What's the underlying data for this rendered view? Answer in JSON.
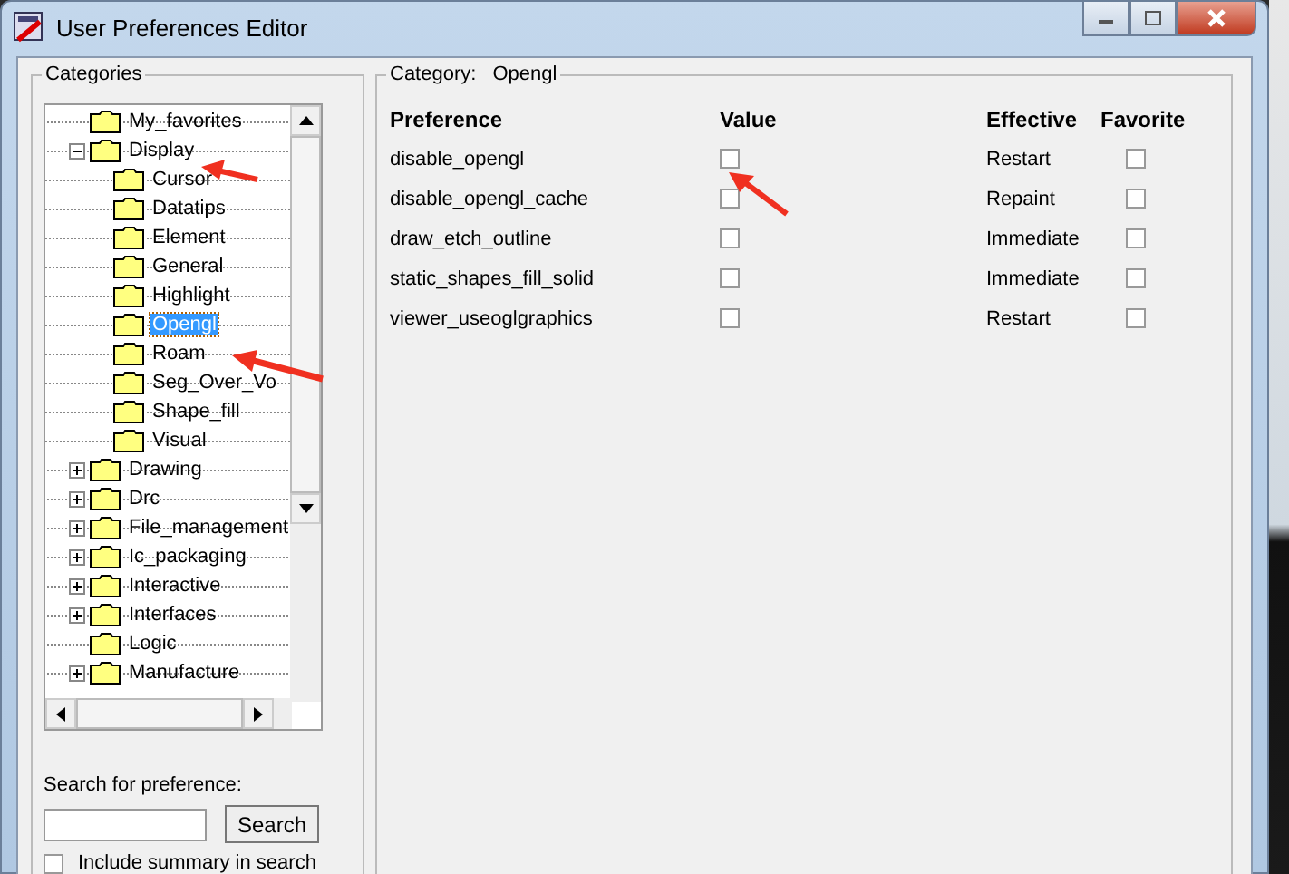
{
  "window": {
    "title": "User Preferences Editor"
  },
  "categories": {
    "title": "Categories",
    "tree": [
      {
        "label": "My_favorites",
        "kind": "leaf",
        "selected": false
      },
      {
        "label": "Display",
        "kind": "group",
        "expanded": true,
        "selected": false,
        "children": [
          {
            "label": "Cursor",
            "selected": false
          },
          {
            "label": "Datatips",
            "selected": false
          },
          {
            "label": "Element",
            "selected": false
          },
          {
            "label": "General",
            "selected": false
          },
          {
            "label": "Highlight",
            "selected": false
          },
          {
            "label": "Opengl",
            "selected": true
          },
          {
            "label": "Roam",
            "selected": false
          },
          {
            "label": "Seg_Over_Vo",
            "selected": false
          },
          {
            "label": "Shape_fill",
            "selected": false
          },
          {
            "label": "Visual",
            "selected": false
          }
        ]
      },
      {
        "label": "Drawing",
        "kind": "group",
        "expanded": false,
        "selected": false
      },
      {
        "label": "Drc",
        "kind": "group",
        "expanded": false,
        "selected": false
      },
      {
        "label": "File_management",
        "kind": "group",
        "expanded": false,
        "selected": false
      },
      {
        "label": "Ic_packaging",
        "kind": "group",
        "expanded": false,
        "selected": false
      },
      {
        "label": "Interactive",
        "kind": "group",
        "expanded": false,
        "selected": false
      },
      {
        "label": "Interfaces",
        "kind": "group",
        "expanded": false,
        "selected": false
      },
      {
        "label": "Logic",
        "kind": "leaf",
        "selected": false
      },
      {
        "label": "Manufacture",
        "kind": "group",
        "expanded": false,
        "selected": false
      }
    ],
    "search_label": "Search for preference:",
    "search_button": "Search",
    "include_summary": {
      "label": "Include summary in search",
      "checked": false
    }
  },
  "category_panel": {
    "caption": "Category:",
    "name": "Opengl",
    "columns": [
      "Preference",
      "Value",
      "Effective",
      "Favorite"
    ],
    "rows": [
      {
        "preference": "disable_opengl",
        "value": false,
        "effective": "Restart",
        "favorite": false
      },
      {
        "preference": "disable_opengl_cache",
        "value": false,
        "effective": "Repaint",
        "favorite": false
      },
      {
        "preference": "draw_etch_outline",
        "value": false,
        "effective": "Immediate",
        "favorite": false
      },
      {
        "preference": "static_shapes_fill_solid",
        "value": false,
        "effective": "Immediate",
        "favorite": false
      },
      {
        "preference": "viewer_useoglgraphics",
        "value": false,
        "effective": "Restart",
        "favorite": false
      }
    ]
  }
}
